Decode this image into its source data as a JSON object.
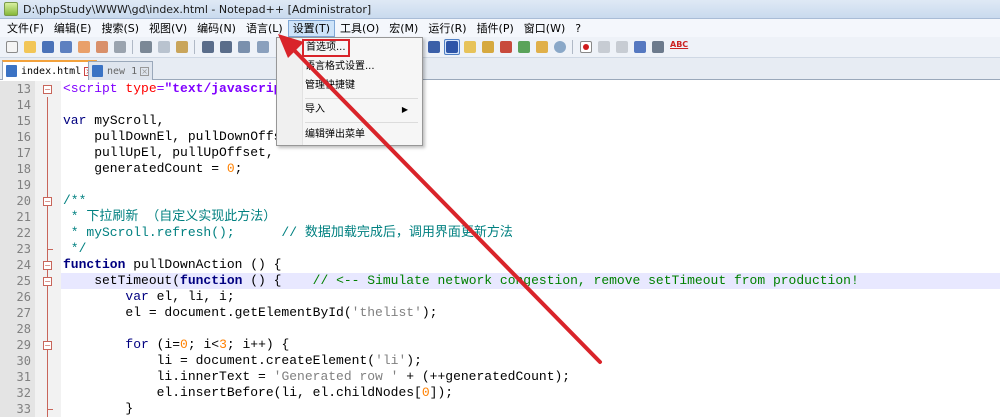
{
  "window": {
    "title": "D:\\phpStudy\\WWW\\gd\\index.html - Notepad++ [Administrator]"
  },
  "menubar": [
    {
      "label": "文件(F)"
    },
    {
      "label": "编辑(E)"
    },
    {
      "label": "搜索(S)"
    },
    {
      "label": "视图(V)"
    },
    {
      "label": "编码(N)"
    },
    {
      "label": "语言(L)"
    },
    {
      "label": "设置(T)"
    },
    {
      "label": "工具(O)"
    },
    {
      "label": "宏(M)"
    },
    {
      "label": "运行(R)"
    },
    {
      "label": "插件(P)"
    },
    {
      "label": "窗口(W)"
    },
    {
      "label": "?"
    }
  ],
  "toolbar": {
    "spellcheck_label": "ABC"
  },
  "tabs": [
    {
      "label": "index.html",
      "close": "×"
    },
    {
      "label": "new 1",
      "close": "×"
    }
  ],
  "settings_menu": {
    "items": [
      {
        "label": "首选项..."
      },
      {
        "label": "语言格式设置..."
      },
      {
        "label": "管理快捷键"
      },
      {
        "label": "导入",
        "arrow": "▶"
      },
      {
        "label": "编辑弹出菜单"
      }
    ]
  },
  "editor": {
    "lines": [
      {
        "n": "13",
        "text": "<script type=\"text/javascript\">"
      },
      {
        "n": "14",
        "text": ""
      },
      {
        "n": "15",
        "text": "var myScroll,"
      },
      {
        "n": "16",
        "text": "    pullDownEl, pullDownOffset,"
      },
      {
        "n": "17",
        "text": "    pullUpEl, pullUpOffset,"
      },
      {
        "n": "18",
        "text": "    generatedCount = 0;"
      },
      {
        "n": "19",
        "text": ""
      },
      {
        "n": "20",
        "text": "/**"
      },
      {
        "n": "21",
        "text": " * 下拉刷新 （自定义实现此方法）"
      },
      {
        "n": "22",
        "text": " * myScroll.refresh();      // 数据加载完成后，调用界面更新方法"
      },
      {
        "n": "23",
        "text": " */"
      },
      {
        "n": "24",
        "text": "function pullDownAction () {"
      },
      {
        "n": "25",
        "text": "    setTimeout(function () {    // <-- Simulate network congestion, remove setTimeout from production!"
      },
      {
        "n": "26",
        "text": "        var el, li, i;"
      },
      {
        "n": "27",
        "text": "        el = document.getElementById('thelist');"
      },
      {
        "n": "28",
        "text": ""
      },
      {
        "n": "29",
        "text": "        for (i=0; i<3; i++) {"
      },
      {
        "n": "30",
        "text": "            li = document.createElement('li');"
      },
      {
        "n": "31",
        "text": "            li.innerText = 'Generated row ' + (++generatedCount);"
      },
      {
        "n": "32",
        "text": "            el.insertBefore(li, el.childNodes[0]);"
      },
      {
        "n": "33",
        "text": "        }"
      }
    ]
  },
  "colors": {
    "annotation": "#d9242a",
    "keyword": "#0000ff",
    "comment": "#008000",
    "string": "#808080",
    "number": "#ff8000",
    "current_line": "#e8e8ff"
  }
}
